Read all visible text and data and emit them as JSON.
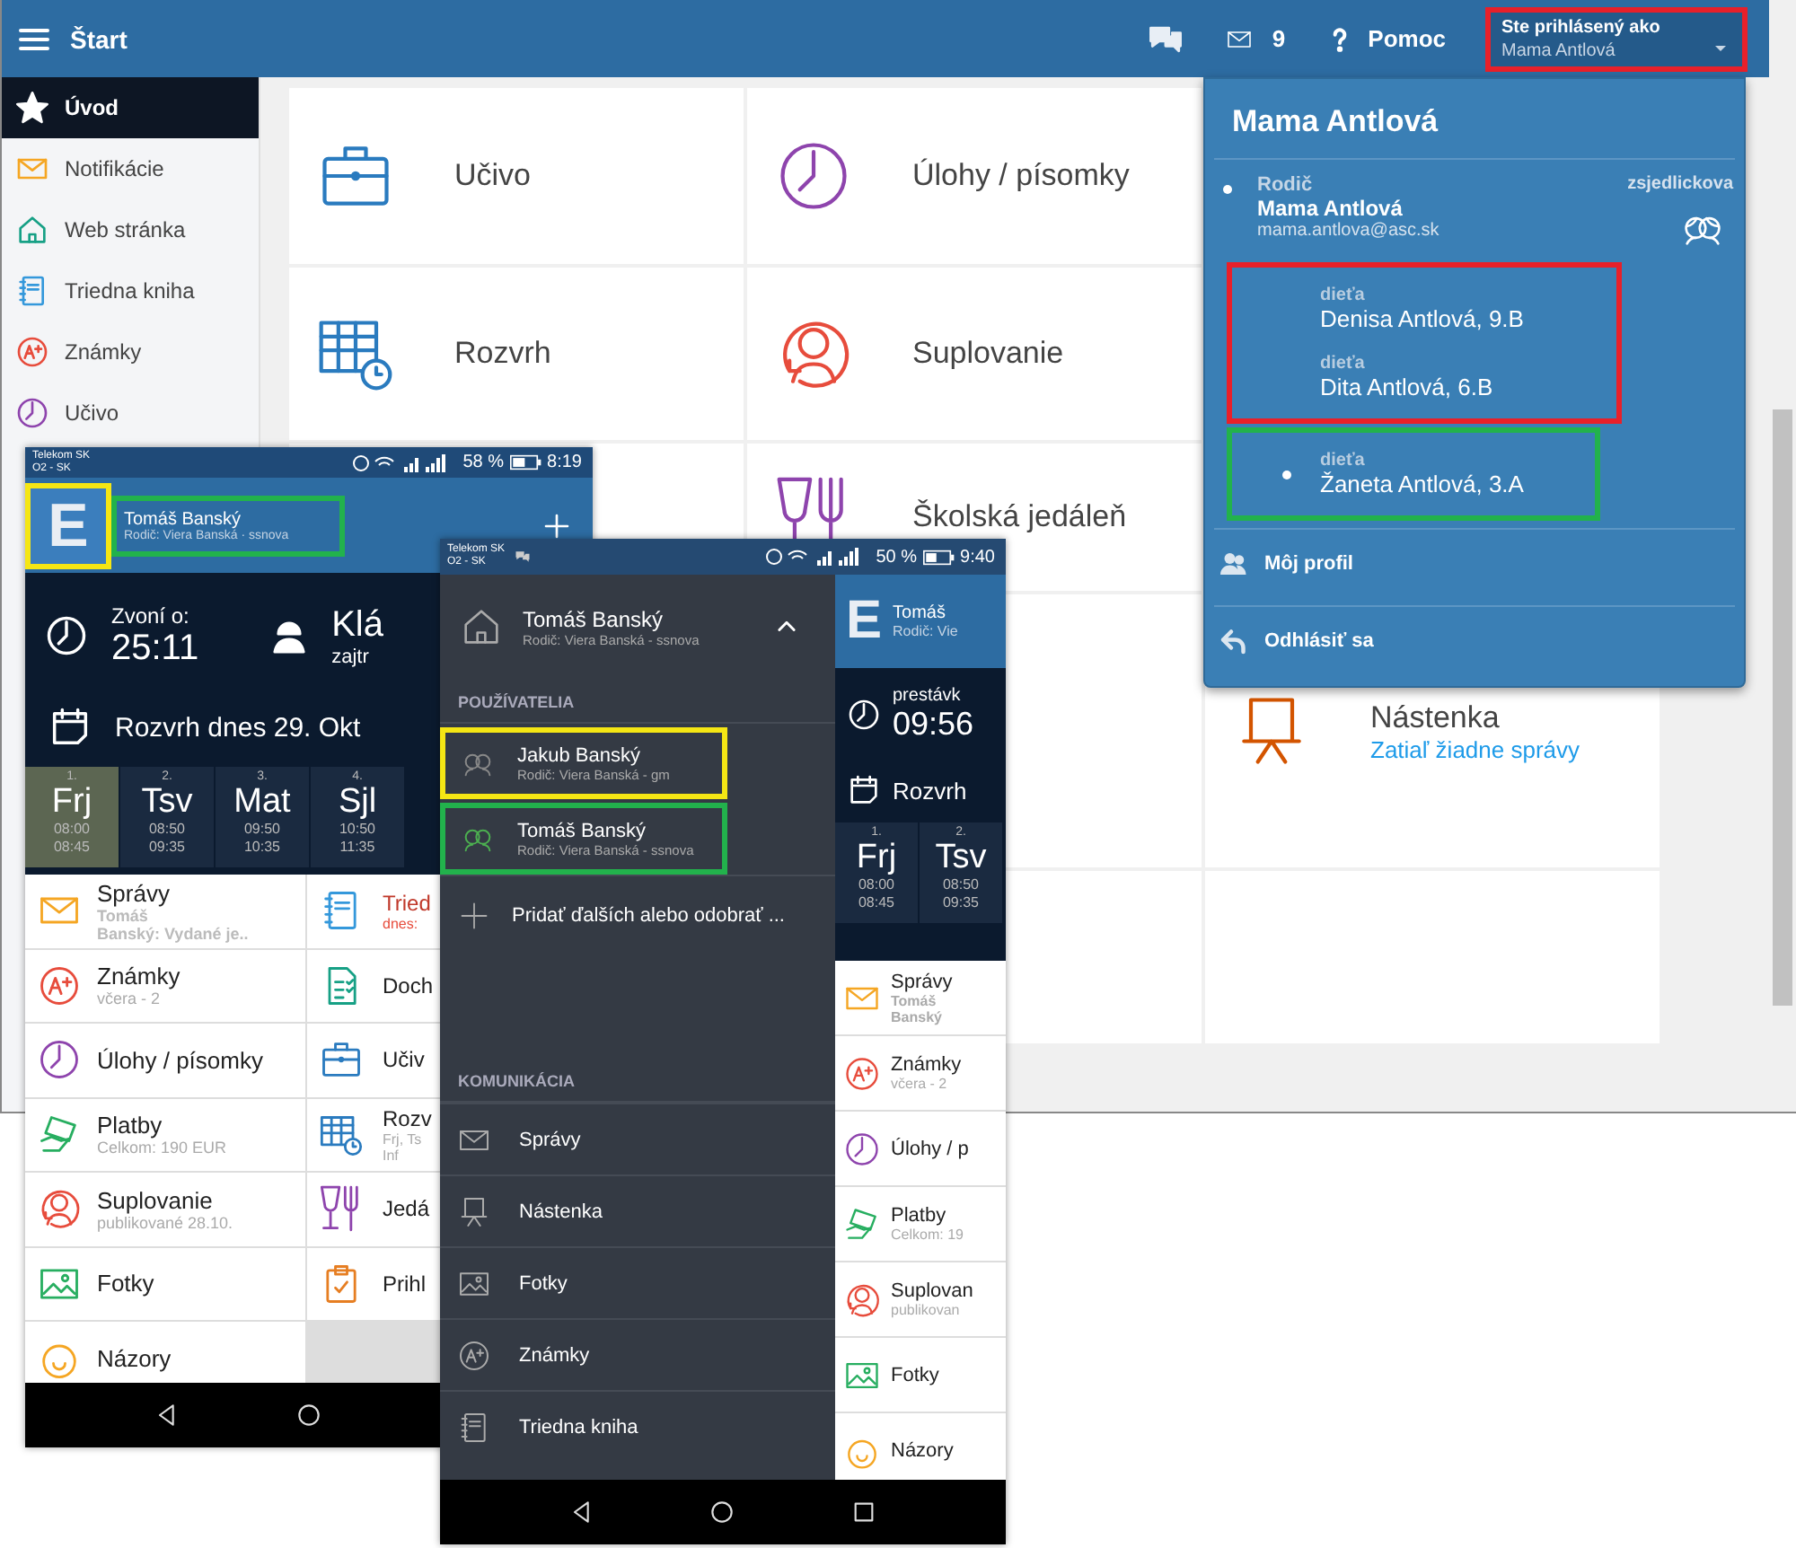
{
  "web": {
    "top_bar": {
      "title": "Štart",
      "mail_count": "9",
      "help": "Pomoc",
      "account": {
        "label": "Ste prihlásený ako",
        "name": "Mama Antlová",
        "color": "#e8202a"
      }
    },
    "sidebar": [
      {
        "label": "Úvod",
        "selected": true
      },
      {
        "label": "Notifikácie",
        "selected": false
      },
      {
        "label": "Web stránka",
        "selected": false
      },
      {
        "label": "Triedna kniha",
        "selected": false
      },
      {
        "label": "Známky",
        "selected": false
      },
      {
        "label": "Učivo",
        "selected": false
      }
    ],
    "tiles": [
      {
        "title": "Učivo"
      },
      {
        "title": "Úlohy / písomky"
      },
      {
        "title": "Rozvrh"
      },
      {
        "title": "Suplovanie"
      },
      {
        "title": "Školská jedáleň"
      },
      {
        "title": "Nástenka",
        "subtitle": "Zatiaľ žiadne správy"
      }
    ]
  },
  "account_menu": {
    "title": "Mama Antlová",
    "user": {
      "role": "Rodič",
      "name": "Mama Antlová",
      "email": "mama.antlova@asc.sk",
      "school": "zsjedlickova",
      "selected": true
    },
    "child_groups": [
      {
        "color": "#e8202a",
        "children": [
          {
            "relation": "dieťa",
            "name": "Denisa Antlová, 9.B",
            "selected": false
          },
          {
            "relation": "dieťa",
            "name": "Dita Antlová, 6.B",
            "selected": false
          }
        ]
      },
      {
        "color": "#22b24c",
        "children": [
          {
            "relation": "dieťa",
            "name": "Žaneta Antlová, 3.A",
            "selected": true
          }
        ]
      }
    ],
    "actions": [
      "Môj profil",
      "Odhlásiť sa"
    ]
  },
  "phone_home": {
    "status": {
      "carrier": "Telekom SK",
      "carrier2": "O2 - SK",
      "battery": "58 %",
      "time": "8:19"
    },
    "header": {
      "logo": "E",
      "name": "Tomáš Banský",
      "subtitle": "Rodič: Viera Banská · ssnova",
      "logo_highlight": {
        "color": "#f5e614"
      },
      "name_highlight": {
        "color": "#22b24c"
      }
    },
    "bell": {
      "label": "Zvoní o:",
      "time": "25:11"
    },
    "teacher": {
      "name": "Klá",
      "when": "zajtr"
    },
    "schedule_title": "Rozvrh dnes 29. Okt",
    "lessons": [
      {
        "number": "1.",
        "subject": "Frj",
        "start": "08:00",
        "end": "08:45",
        "selected": true
      },
      {
        "number": "2.",
        "subject": "Tsv",
        "start": "08:50",
        "end": "09:35",
        "selected": false
      },
      {
        "number": "3.",
        "subject": "Mat",
        "start": "09:50",
        "end": "10:35",
        "selected": false
      },
      {
        "number": "4.",
        "subject": "Sjl",
        "start": "10:50",
        "end": "11:35",
        "selected": false
      }
    ],
    "tiles": [
      {
        "title": "Správy",
        "lines": [
          "Tomáš",
          "Banský: Vydané je.."
        ],
        "alert": false
      },
      {
        "title": "Tried",
        "lines": [
          "dnes:"
        ],
        "alert": true
      },
      {
        "title": "Známky",
        "lines": [
          "včera - 2"
        ],
        "alert": false
      },
      {
        "title": "Doch",
        "alert": false
      },
      {
        "title": "Úlohy / písomky",
        "alert": false
      },
      {
        "title": "Učiv",
        "alert": false
      },
      {
        "title": "Platby",
        "lines": [
          "Celkom: 190 EUR"
        ],
        "alert": false
      },
      {
        "title": "Rozv",
        "lines": [
          "Frj, Ts",
          "Inf"
        ],
        "alert": false
      },
      {
        "title": "Suplovanie",
        "lines": [
          "publikované 28.10."
        ],
        "alert": false
      },
      {
        "title": "Jedá",
        "alert": false
      },
      {
        "title": "Fotky",
        "alert": false
      },
      {
        "title": "Prihl",
        "alert": false
      },
      {
        "title": "Názory",
        "alert": false
      }
    ]
  },
  "phone_drawer": {
    "status": {
      "carrier": "Telekom SK",
      "carrier2": "O2 - SK",
      "battery": "50 %",
      "time": "9:40"
    },
    "header": {
      "name": "Tomáš Banský",
      "subtitle": "Rodič: Viera Banská - ssnova",
      "expanded": true
    },
    "users_heading": "POUŽÍVATELIA",
    "users": [
      {
        "name": "Jakub Banský",
        "subtitle": "Rodič: Viera Banská - gm",
        "selected": false,
        "color": "#f5e614"
      },
      {
        "name": "Tomáš Banský",
        "subtitle": "Rodič: Viera Banská - ssnova",
        "selected": true,
        "color": "#22b24c"
      }
    ],
    "add_label": "Pridať ďalších alebo odobrať ...",
    "section_heading": "KOMUNIKÁCIA",
    "items": [
      "Správy",
      "Nástenka",
      "Fotky",
      "Známky",
      "Triedna kniha"
    ],
    "app": {
      "logo": "E",
      "name": "Tomáš",
      "subtitle": "Rodič: Vie",
      "bell_label": "prestávk",
      "bell_time": "09:56",
      "schedule_title": "Rozvrh",
      "lessons": [
        {
          "number": "1.",
          "subject": "Frj",
          "start": "08:00",
          "end": "08:45"
        },
        {
          "number": "2.",
          "subject": "Tsv",
          "start": "08:50",
          "end": "09:35"
        }
      ],
      "tiles": [
        {
          "title": "Správy",
          "lines": [
            "Tomáš",
            "Banský"
          ]
        },
        {
          "title": "Známky",
          "lines": [
            "včera - 2"
          ]
        },
        {
          "title": "Úlohy / p"
        },
        {
          "title": "Platby",
          "lines": [
            "Celkom: 19"
          ]
        },
        {
          "title": "Suplovan",
          "lines": [
            "publikovan"
          ]
        },
        {
          "title": "Fotky"
        },
        {
          "title": "Názory"
        }
      ]
    }
  }
}
